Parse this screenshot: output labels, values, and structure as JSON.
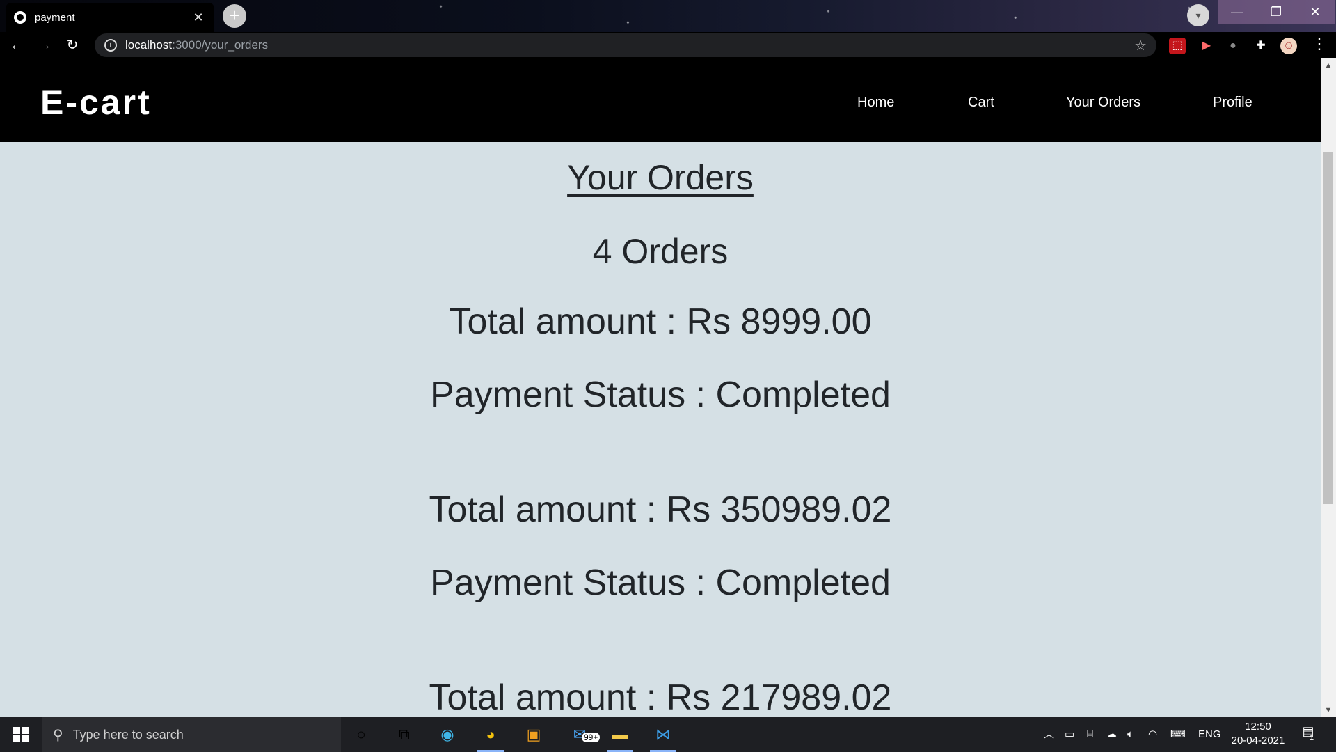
{
  "browser": {
    "tab_title": "payment",
    "tab_close": "✕",
    "new_tab": "+",
    "url_host": "localhost",
    "url_path": ":3000/your_orders"
  },
  "site": {
    "brand": "E-cart",
    "nav": {
      "home": "Home",
      "cart": "Cart",
      "orders": "Your Orders",
      "profile": "Profile"
    }
  },
  "orders_page": {
    "heading": "Your Orders",
    "count_text": "4 Orders",
    "entries": [
      {
        "total": "Total amount : Rs 8999.00",
        "status": "Payment Status : Completed"
      },
      {
        "total": "Total amount : Rs 350989.02",
        "status": "Payment Status : Completed"
      },
      {
        "total": "Total amount : Rs 217989.02"
      }
    ]
  },
  "taskbar": {
    "search_placeholder": "Type here to search",
    "mail_badge": "99+",
    "language": "ENG",
    "time": "12:50",
    "date": "20-04-2021",
    "notification_count": "1"
  },
  "colors": {
    "page_bg": "#d5e0e5",
    "nav_bg": "#000000",
    "text": "#212529"
  }
}
